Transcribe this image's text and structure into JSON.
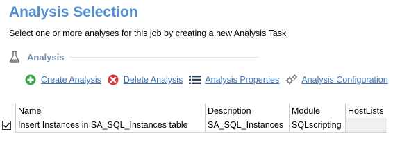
{
  "page": {
    "title": "Analysis Selection",
    "subtitle": "Select one or more analyses for this job by creating a new Analysis Task"
  },
  "section": {
    "label": "Analysis",
    "icon": "flask-icon"
  },
  "toolbar": {
    "create_label": "Create Analysis",
    "create_icon": "plus-circle-icon",
    "delete_label": "Delete Analysis",
    "delete_icon": "x-circle-icon",
    "properties_label": "Analysis Properties",
    "properties_icon": "list-icon",
    "configuration_label": "Analysis Configuration",
    "configuration_icon": "gears-icon"
  },
  "table": {
    "columns": [
      "Name",
      "Description",
      "Module",
      "HostLists"
    ],
    "rows": [
      {
        "checked": true,
        "name": "Insert Instances in SA_SQL_Instances table",
        "description": "SA_SQL_Instances",
        "module": "SQLscripting",
        "hostlists": ""
      }
    ]
  },
  "colors": {
    "title": "#4f8fd2",
    "section_label": "#7690ad",
    "link": "#3a73b5",
    "create_icon": "#3aa648",
    "delete_icon": "#d9383a"
  }
}
